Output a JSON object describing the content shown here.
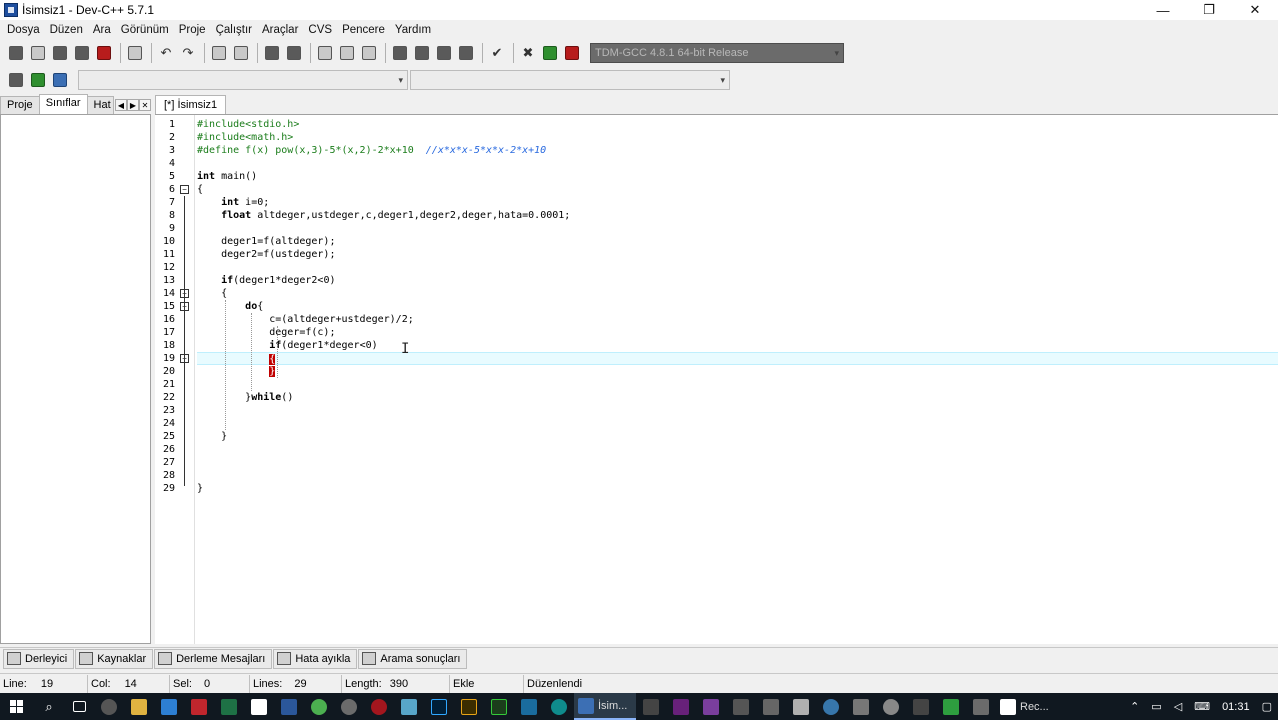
{
  "window": {
    "title": "İsimsiz1 - Dev-C++ 5.7.1",
    "minimize": "—",
    "restore": "❐",
    "close": "✕"
  },
  "menu": [
    "Dosya",
    "Düzen",
    "Ara",
    "Görünüm",
    "Proje",
    "Çalıştır",
    "Araçlar",
    "CVS",
    "Pencere",
    "Yardım"
  ],
  "toolbar": {
    "compiler_combo": "TDM-GCC 4.8.1 64-bit Release",
    "combo2": "",
    "combo3": ""
  },
  "left_panel": {
    "tabs": [
      "Proje",
      "Sınıflar",
      "Hat"
    ],
    "active_tab": "Sınıflar"
  },
  "editor": {
    "tab_label": "[*] İsimsiz1",
    "lines": [
      {
        "n": "1",
        "text": "#include<stdio.h>",
        "cls": "pp"
      },
      {
        "n": "2",
        "text": "#include<math.h>",
        "cls": "pp"
      },
      {
        "n": "3",
        "text": "#define f(x) pow(x,3)-5*(x,2)-2*x+10  //x*x*x-5*x*x-2*x+10",
        "cls": "def"
      },
      {
        "n": "4",
        "text": "",
        "cls": ""
      },
      {
        "n": "5",
        "text": "int main()",
        "cls": "main"
      },
      {
        "n": "6",
        "text": "{",
        "cls": ""
      },
      {
        "n": "7",
        "text": "    int i=0;",
        "cls": "int"
      },
      {
        "n": "8",
        "text": "    float altdeger,ustdeger,c,deger1,deger2,deger,hata=0.0001;",
        "cls": "float"
      },
      {
        "n": "9",
        "text": "",
        "cls": ""
      },
      {
        "n": "10",
        "text": "    deger1=f(altdeger);",
        "cls": ""
      },
      {
        "n": "11",
        "text": "    deger2=f(ustdeger);",
        "cls": ""
      },
      {
        "n": "12",
        "text": "",
        "cls": ""
      },
      {
        "n": "13",
        "text": "    if(deger1*deger2<0)",
        "cls": "if"
      },
      {
        "n": "14",
        "text": "    {",
        "cls": ""
      },
      {
        "n": "15",
        "text": "        do{",
        "cls": "do"
      },
      {
        "n": "16",
        "text": "            c=(altdeger+ustdeger)/2;",
        "cls": ""
      },
      {
        "n": "17",
        "text": "            deger=f(c);",
        "cls": ""
      },
      {
        "n": "18",
        "text": "            if(deger1*deger<0)",
        "cls": "if"
      },
      {
        "n": "19",
        "text": "            {",
        "cls": "hlbrace"
      },
      {
        "n": "20",
        "text": "            }",
        "cls": "hlbrace"
      },
      {
        "n": "21",
        "text": "",
        "cls": ""
      },
      {
        "n": "22",
        "text": "        }while()",
        "cls": "while"
      },
      {
        "n": "23",
        "text": "",
        "cls": ""
      },
      {
        "n": "24",
        "text": "",
        "cls": ""
      },
      {
        "n": "25",
        "text": "    }",
        "cls": ""
      },
      {
        "n": "26",
        "text": "",
        "cls": ""
      },
      {
        "n": "27",
        "text": "",
        "cls": ""
      },
      {
        "n": "28",
        "text": "",
        "cls": ""
      },
      {
        "n": "29",
        "text": "}",
        "cls": ""
      }
    ]
  },
  "bottom_tabs": [
    "Derleyici",
    "Kaynaklar",
    "Derleme Mesajları",
    "Hata ayıkla",
    "Arama sonuçları"
  ],
  "status": {
    "line_label": "Line:",
    "line_value": "19",
    "col_label": "Col:",
    "col_value": "14",
    "sel_label": "Sel:",
    "sel_value": "0",
    "lines_label": "Lines:",
    "lines_value": "29",
    "length_label": "Length:",
    "length_value": "390",
    "mode": "Ekle",
    "state": "Düzenlendi"
  },
  "taskbar": {
    "devcpp_label": "İsim...",
    "rec_label": "Rec...",
    "time": "01:31"
  }
}
